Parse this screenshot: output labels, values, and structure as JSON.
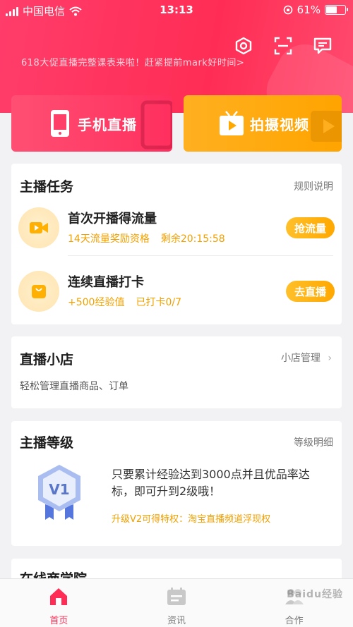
{
  "status_bar": {
    "carrier": "中国电信",
    "time": "13:13",
    "battery": "61%",
    "battery_level": 0.61
  },
  "header": {
    "banner_text": "618大促直播完整课表来啦！赶紧提前mark好时间>",
    "icons": [
      "settings-icon",
      "scan-icon",
      "message-icon"
    ]
  },
  "live_buttons": {
    "phone_live": "手机直播",
    "video_shoot": "拍摄视频"
  },
  "tasks": {
    "title": "主播任务",
    "link": "规则说明",
    "items": [
      {
        "title": "首次开播得流量",
        "sub1": "14天流量奖励资格",
        "sub2": "剩余20:15:58",
        "button": "抢流量"
      },
      {
        "title": "连续直播打卡",
        "sub1": "+500经验值",
        "sub2": "已打卡0/7",
        "button": "去直播"
      }
    ]
  },
  "shop": {
    "title": "直播小店",
    "link": "小店管理",
    "desc": "轻松管理直播商品、订单"
  },
  "level": {
    "title": "主播等级",
    "link": "等级明细",
    "badge": "V1",
    "text": "只要累计经验达到3000点并且优品率达标，即可升到2级哦！",
    "perk": "升级V2可得特权：淘宝直播频道浮现权"
  },
  "academy": {
    "title": "在线商学院"
  },
  "tabbar": {
    "items": [
      {
        "label": "首页",
        "icon": "home-icon",
        "active": true
      },
      {
        "label": "资讯",
        "icon": "news-icon",
        "active": false
      },
      {
        "label": "合作",
        "icon": "cooperate-icon",
        "active": false
      }
    ]
  },
  "watermark": "Baidu经验",
  "colors": {
    "brand_red": "#ff2d55",
    "accent_orange": "#ffa800",
    "accent_text": "#f0a000"
  }
}
